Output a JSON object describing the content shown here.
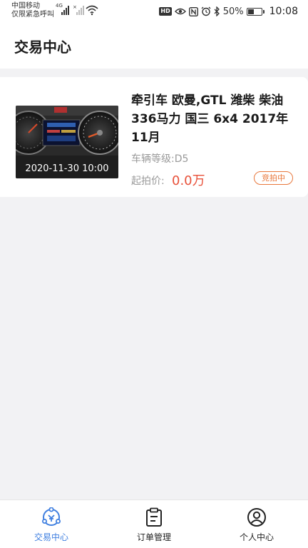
{
  "status_bar": {
    "carrier_line1": "中国移动",
    "carrier_line2": "仅限紧急呼叫",
    "network_type": "4G",
    "battery": "50%",
    "battery_level": 0.5,
    "time": "10:08",
    "hd_label": "HD",
    "icons": [
      "signal-icon",
      "no-signal-icon",
      "wifi-icon",
      "hd-icon",
      "eye-icon",
      "nfc-icon",
      "alarm-icon",
      "bluetooth-icon",
      "battery-icon"
    ]
  },
  "header": {
    "title": "交易中心"
  },
  "listing": {
    "title": "牵引车 欧曼,GTL 潍柴 柴油 336马力 国三 6x4 2017年11月",
    "date": "2020-11-30 10:00",
    "grade": "车辆等级:D5",
    "price_label": "起拍价:",
    "price_value": "0.0万",
    "status": "竞拍中",
    "accent_color": "#e8513a"
  },
  "bottom_nav": {
    "items": [
      {
        "label": "交易中心",
        "icon": "exchange-hub-icon",
        "active": true
      },
      {
        "label": "订单管理",
        "icon": "clipboard-icon",
        "active": false
      },
      {
        "label": "个人中心",
        "icon": "user-icon",
        "active": false
      }
    ],
    "active_color": "#3f7fe0"
  }
}
